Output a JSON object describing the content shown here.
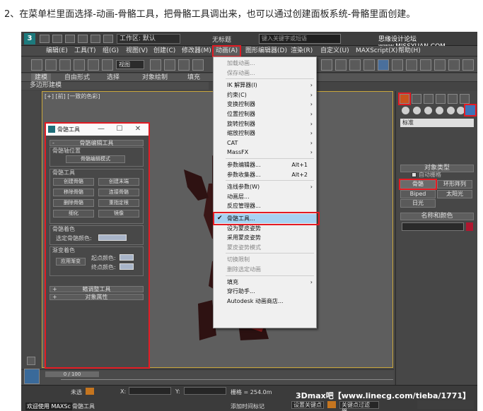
{
  "caption": "2、在菜单栏里面选择-动画-骨骼工具，把骨骼工具调出来，也可以通过创建面板系统-骨骼里面创建。",
  "window": {
    "title": "无标题",
    "workspace_label": "工作区: 默认",
    "search_placeholder": "键入关键字或短语",
    "watermark_top": "思缘设计论坛 www.MISSYUAN.COM",
    "logo_text": "3"
  },
  "menubar": {
    "items": [
      "编辑(E)",
      "工具(T)",
      "组(G)",
      "视图(V)",
      "创建(C)",
      "修改器(M)",
      "动画(A)",
      "图形编辑器(D)",
      "渲染(R)",
      "自定义(U)",
      "MAXScript(X)",
      "帮助(H)"
    ]
  },
  "toolbar": {
    "view_dropdown": "视图"
  },
  "ribbon": {
    "tabs": [
      "建模",
      "自由形式",
      "选择",
      "对象绘制",
      "填充"
    ],
    "subtab": "多边形建模"
  },
  "viewport": {
    "label": "[+] [前] [一致的色彩]"
  },
  "animation_menu": {
    "items": [
      {
        "label": "加载动画...",
        "dim": true
      },
      {
        "label": "保存动画...",
        "dim": true
      },
      {
        "label": "IK 解算器(I)",
        "arrow": true
      },
      {
        "label": "约束(C)",
        "arrow": true
      },
      {
        "label": "变换控制器",
        "arrow": true
      },
      {
        "label": "位置控制器",
        "arrow": true
      },
      {
        "label": "旋转控制器",
        "arrow": true
      },
      {
        "label": "缩放控制器",
        "arrow": true
      },
      {
        "label": "CAT",
        "arrow": true
      },
      {
        "label": "MassFX",
        "arrow": true
      },
      {
        "label": "参数编辑器...",
        "shortcut": "Alt+1"
      },
      {
        "label": "参数收集器...",
        "shortcut": "Alt+2"
      },
      {
        "label": "连线参数(W)",
        "arrow": true
      },
      {
        "label": "动画层..."
      },
      {
        "label": "反应管理器..."
      },
      {
        "label": "骨骼工具...",
        "selected": true,
        "checked": "✔"
      },
      {
        "label": "设为蒙皮姿势"
      },
      {
        "label": "采用蒙皮姿势"
      },
      {
        "label": "蒙皮姿势模式",
        "dim": true
      },
      {
        "label": "切换限制",
        "dim": true
      },
      {
        "label": "删除选定动画",
        "dim": true
      },
      {
        "label": "填充",
        "arrow": true
      },
      {
        "label": "穿行助手..."
      },
      {
        "label": "Autodesk 动画商店..."
      }
    ],
    "arrow_glyph": "›"
  },
  "bone_tools": {
    "title": "骨骼工具",
    "close_glyph": "✕",
    "min_glyph": "—",
    "max_glyph": "☐",
    "rollout_edit": "骨骼编辑工具",
    "pivot_label": "骨骼轴位置",
    "edit_mode_btn": "骨骼编辑模式",
    "tools_label": "骨骼工具",
    "buttons": [
      "创建骨骼",
      "创建末端",
      "移除骨骼",
      "连接骨骼",
      "删除骨骼",
      "重指定根",
      "细化",
      "镜像"
    ],
    "coloring_label": "骨骼着色",
    "selected_color_label": "选定骨骼颜色:",
    "gradient_label": "渐变着色",
    "apply_gradient_btn": "应用渐变",
    "start_color_label": "起点颜色:",
    "end_color_label": "终点颜色:",
    "rollout_fin": "鳍调整工具",
    "rollout_props": "对象属性",
    "plus": "+",
    "minus": "-"
  },
  "command_panel": {
    "dropdown": "标准",
    "rollout_types": "对象类型",
    "autogrid": "自动栅格",
    "buttons": [
      "骨骼",
      "环形阵列",
      "Biped",
      "太阳光",
      "日光"
    ],
    "rollout_name": "名称和颜色",
    "swatch_color": "#b0162f"
  },
  "timeline": {
    "frame": "0 / 100"
  },
  "status": {
    "not_selected": "未选",
    "x_label": "X:",
    "y_label": "Y:",
    "grid_label": "栅格 = 254.0m",
    "welcome": "欢迎使用 MAXSc",
    "tool_label": "骨骼工具",
    "add_time_tag": "添加时间标记",
    "set_key_btn": "设置关键点",
    "key_filter": "关键点过滤器...",
    "watermark_bottom": "3Dmax吧【www.linecg.com/tieba/1771】"
  }
}
